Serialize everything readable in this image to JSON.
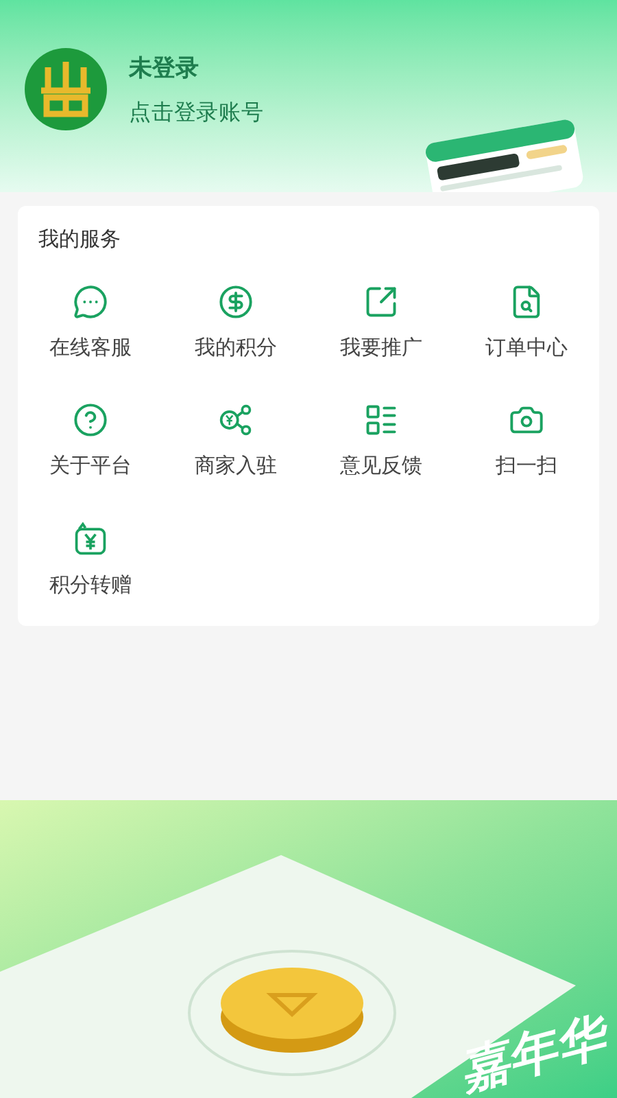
{
  "profile": {
    "name": "未登录",
    "hint": "点击登录账号"
  },
  "services": {
    "title": "我的服务",
    "items": [
      {
        "label": "在线客服"
      },
      {
        "label": "我的积分"
      },
      {
        "label": "我要推广"
      },
      {
        "label": "订单中心"
      },
      {
        "label": "关于平台"
      },
      {
        "label": "商家入驻"
      },
      {
        "label": "意见反馈"
      },
      {
        "label": "扫一扫"
      },
      {
        "label": "积分转赠"
      }
    ]
  },
  "banner": {
    "text": "嘉年华"
  }
}
